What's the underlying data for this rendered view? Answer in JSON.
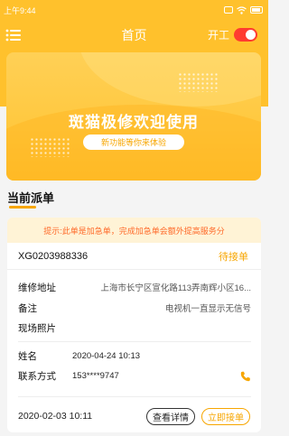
{
  "status_bar": {
    "time": "上午9:44"
  },
  "header": {
    "title": "首页",
    "work_label": "开工",
    "work_on": true
  },
  "banner": {
    "title": "斑猫极修欢迎使用",
    "button_label": "新功能等你来体验"
  },
  "section": {
    "title": "当前派单"
  },
  "order": {
    "notice": "提示:此单是加急单，完成加急单会额外提高服务分",
    "order_no": "XG0203988336",
    "status": "待接单",
    "address_label": "维修地址",
    "address_value": "上海市长宁区宣化路113弄南辉小区16...",
    "remark_label": "备注",
    "remark_value": "电视机一直显示无信号",
    "photo_label": "现场照片",
    "name_label": "姓名",
    "name_value": "2020-04-24 10:13",
    "contact_label": "联系方式",
    "contact_value": "153****9747",
    "created_time": "2020-02-03 10:11",
    "detail_button": "查看详情",
    "accept_button": "立即接单"
  },
  "colors": {
    "brand": "#ffc12c",
    "accent": "#f7a600",
    "notice_text": "#ff6a2a",
    "switch_on": "#ff3b30"
  },
  "icons": [
    "menu-icon",
    "phone-icon",
    "wifi-icon",
    "battery-icon"
  ]
}
